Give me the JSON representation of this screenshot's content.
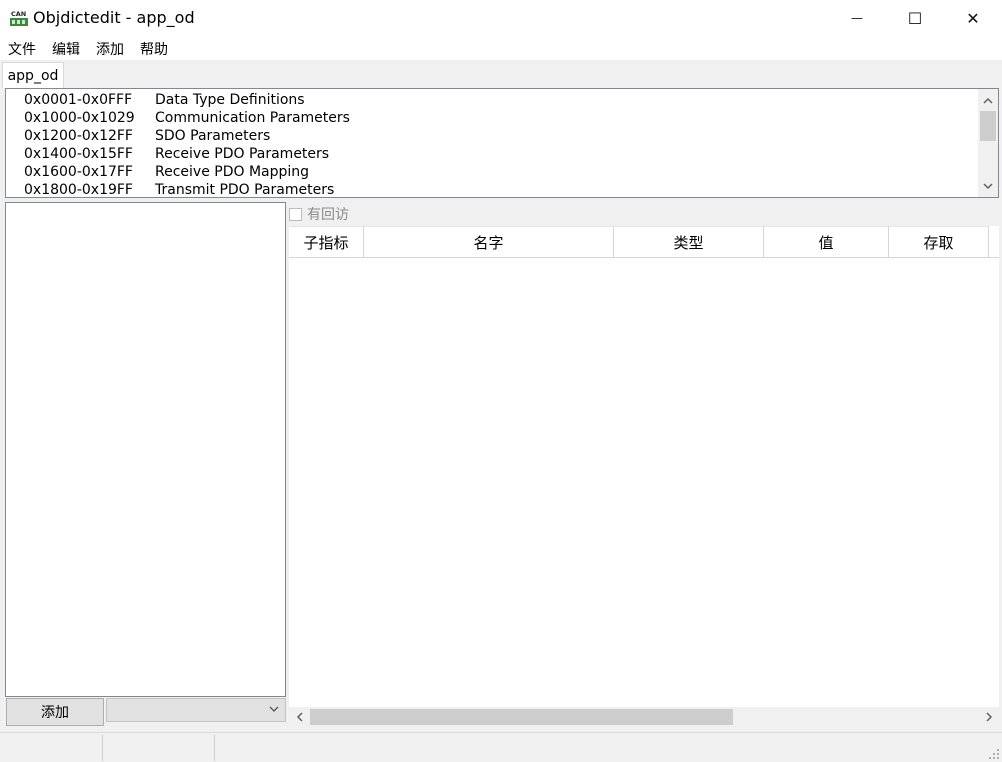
{
  "window": {
    "title": "Objdictedit - app_od",
    "icon": "can-icon",
    "minimize_glyph": "—",
    "maximize_glyph": "☐",
    "close_glyph": "✕"
  },
  "menu": [
    "文件",
    "编辑",
    "添加",
    "帮助"
  ],
  "tab": {
    "label": "app_od"
  },
  "index_list": [
    {
      "range": "0x0001-0x0FFF",
      "name": "Data Type Definitions"
    },
    {
      "range": "0x1000-0x1029",
      "name": "Communication Parameters"
    },
    {
      "range": "0x1200-0x12FF",
      "name": "SDO Parameters"
    },
    {
      "range": "0x1400-0x15FF",
      "name": "Receive PDO Parameters"
    },
    {
      "range": "0x1600-0x17FF",
      "name": "Receive PDO Mapping"
    },
    {
      "range": "0x1800-0x19FF",
      "name": "Transmit PDO Parameters"
    }
  ],
  "left_panel": {
    "add_button": "添加",
    "combo_value": ""
  },
  "checkbox": {
    "label": "有回访",
    "checked": false
  },
  "grid": {
    "columns": [
      "子指标",
      "名字",
      "类型",
      "值",
      "存取"
    ]
  },
  "status_bar": [
    "",
    "",
    ""
  ]
}
